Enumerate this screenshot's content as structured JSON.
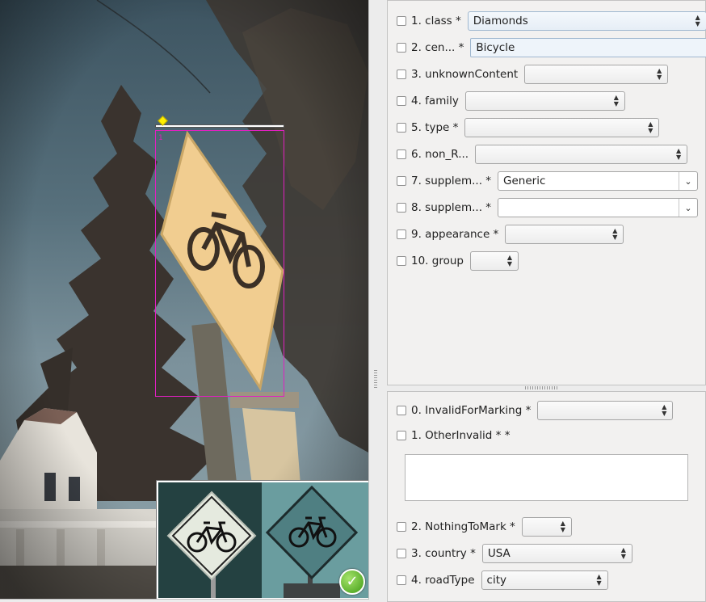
{
  "viewer": {
    "annotation_index": "1",
    "preview_status_icon": "checkmark-icon"
  },
  "attributes": {
    "fields": [
      {
        "label": "1. class *",
        "value": "Diamonds",
        "kind": "spin"
      },
      {
        "label": "2. cen... *",
        "value": "Bicycle",
        "kind": "text"
      },
      {
        "label": "3. unknownContent",
        "value": "",
        "kind": "spin"
      },
      {
        "label": "4. family",
        "value": "",
        "kind": "spin"
      },
      {
        "label": "5. type *",
        "value": "",
        "kind": "spin"
      },
      {
        "label": "6. non_R...",
        "value": "",
        "kind": "spin"
      },
      {
        "label": "7. supplem... *",
        "value": "Generic",
        "kind": "dropdown"
      },
      {
        "label": "8. supplem... *",
        "value": "",
        "kind": "dropdown"
      },
      {
        "label": "9. appearance *",
        "value": "",
        "kind": "spin"
      },
      {
        "label": "10. group",
        "value": "",
        "kind": "spin"
      }
    ]
  },
  "validity": {
    "fields": [
      {
        "label": "0. InvalidForMarking *",
        "value": ""
      },
      {
        "label": "1. OtherInvalid * *",
        "value": ""
      },
      {
        "label": "2. NothingToMark *",
        "value": ""
      },
      {
        "label": "3. country *",
        "value": "USA"
      },
      {
        "label": "4. roadType",
        "value": "city"
      }
    ]
  },
  "colors": {
    "bbox": "#e020c0",
    "handle": "#ffef00",
    "sign_face": "#f1cd90"
  }
}
